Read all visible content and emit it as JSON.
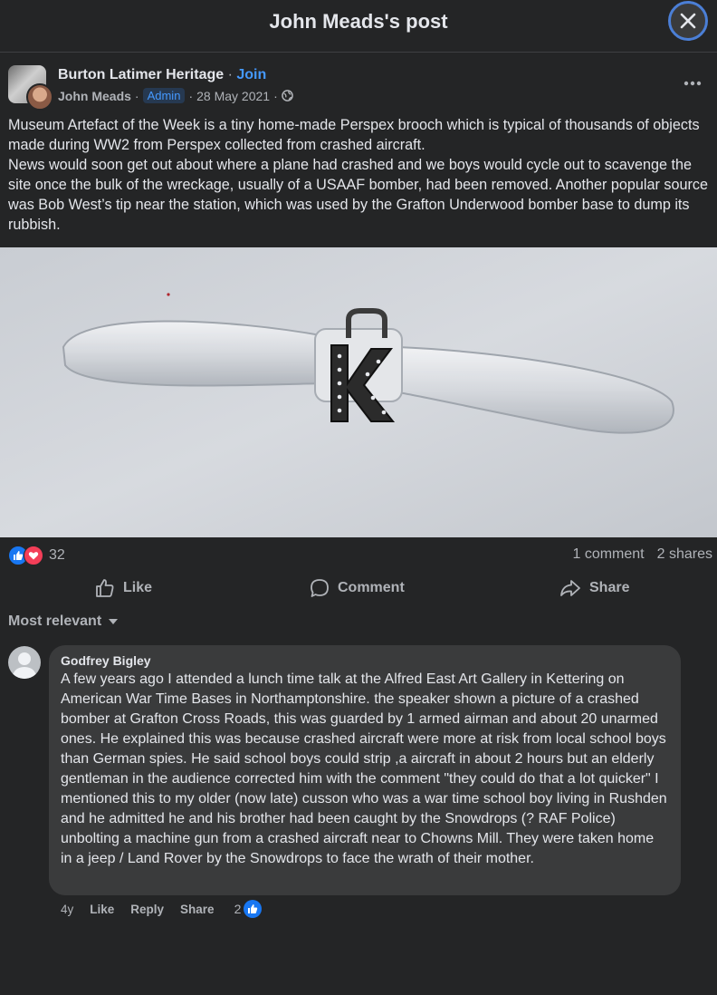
{
  "window": {
    "title": "John Meads's post"
  },
  "post": {
    "group_name": "Burton Latimer Heritage",
    "separator": "·",
    "join_label": "Join",
    "author": "John Meads",
    "badge": "Admin",
    "date": "28 May 2021",
    "text_lines": [
      "Museum Artefact of the Week is a tiny home-made Perspex brooch which is typical of thousands of objects made during WW2 from Perspex collected from crashed aircraft.",
      "News would soon get out about where a plane had crashed and we boys would cycle out to scavenge the site once the bulk of the wreckage, usually of a USAAF bomber, had been removed. Another popular source was Bob West’s tip near the station, which was used by the Grafton Underwood bomber base to dump its rubbish."
    ],
    "reaction_count": "32",
    "comments_count": "1 comment",
    "shares_count": "2 shares"
  },
  "actions": {
    "like": "Like",
    "comment": "Comment",
    "share": "Share"
  },
  "sort_label": "Most relevant",
  "comment": {
    "name": "Godfrey Bigley",
    "text": "A few years ago I attended a lunch time talk at the Alfred East Art Gallery in Kettering on American War Time Bases in Northamptonshire. the speaker shown a picture of a crashed bomber at Grafton Cross Roads, this was guarded by 1 armed airman and about 20 unarmed ones. He explained this was because crashed aircraft were more at risk from local school boys than German spies. He said school boys could strip ,a aircraft in about 2 hours but an elderly gentleman in the audience corrected him with the comment \"they could do that a lot quicker\" I mentioned this to my older (now late) cusson who was a war time school boy living in Rushden and he admitted he and his brother had been caught by the Snowdrops (? RAF Police) unbolting a machine gun from a crashed aircraft near to Chowns Mill. They were taken home in a jeep / Land Rover by the Snowdrops to face the wrath of their mother.",
    "age": "4y",
    "like": "Like",
    "reply": "Reply",
    "share": "Share",
    "like_count": "2"
  },
  "colors": {
    "background": "#242526",
    "accent": "#4599ff",
    "like_blue": "#1877f2",
    "love_red": "#f33e58",
    "bubble": "#3a3b3c"
  }
}
